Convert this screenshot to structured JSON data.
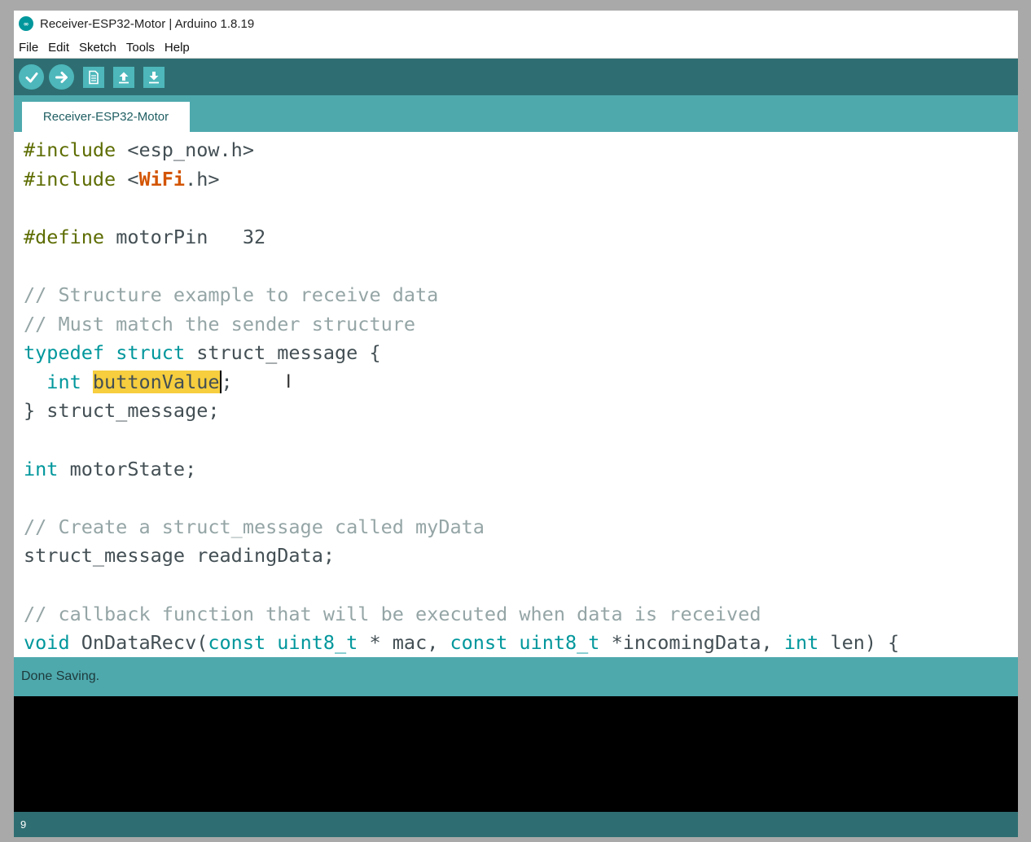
{
  "window": {
    "title": "Receiver-ESP32-Motor | Arduino 1.8.19",
    "app_icon_text": "∞"
  },
  "menu": [
    "File",
    "Edit",
    "Sketch",
    "Tools",
    "Help"
  ],
  "toolbar": {
    "buttons": [
      "verify-icon",
      "upload-icon",
      "new-icon",
      "open-icon",
      "save-icon"
    ]
  },
  "tab": {
    "label": "Receiver-ESP32-Motor"
  },
  "code_lines": [
    [
      {
        "t": "#include",
        "c": "pp"
      },
      {
        "t": " <esp_now.h>"
      }
    ],
    [
      {
        "t": "#include",
        "c": "pp"
      },
      {
        "t": " <"
      },
      {
        "t": "WiFi",
        "c": "lib"
      },
      {
        "t": ".h>"
      }
    ],
    [],
    [
      {
        "t": "#define",
        "c": "pp"
      },
      {
        "t": " motorPin   32"
      }
    ],
    [],
    [
      {
        "t": "// Structure example to receive data",
        "c": "cm"
      }
    ],
    [
      {
        "t": "// Must match the sender structure",
        "c": "cm"
      }
    ],
    [
      {
        "t": "typedef",
        "c": "kw"
      },
      {
        "t": " "
      },
      {
        "t": "struct",
        "c": "kw"
      },
      {
        "t": " struct_message {"
      }
    ],
    [
      {
        "t": "  "
      },
      {
        "t": "int",
        "c": "kw"
      },
      {
        "t": " "
      },
      {
        "t": "buttonValue",
        "c": "hl caret"
      },
      {
        "t": ";"
      }
    ],
    [
      {
        "t": "} struct_message;"
      }
    ],
    [],
    [
      {
        "t": "int",
        "c": "kw"
      },
      {
        "t": " motorState;"
      }
    ],
    [],
    [
      {
        "t": "// Create a struct_message called myData",
        "c": "cm"
      }
    ],
    [
      {
        "t": "struct_message readingData;"
      }
    ],
    [],
    [
      {
        "t": "// callback function that will be executed when data is received",
        "c": "cm"
      }
    ],
    [
      {
        "t": "void",
        "c": "kw"
      },
      {
        "t": " OnDataRecv("
      },
      {
        "t": "const",
        "c": "kw"
      },
      {
        "t": " "
      },
      {
        "t": "uint8_t",
        "c": "kw"
      },
      {
        "t": " * mac, "
      },
      {
        "t": "const",
        "c": "kw"
      },
      {
        "t": " "
      },
      {
        "t": "uint8_t",
        "c": "kw"
      },
      {
        "t": " *incomingData, "
      },
      {
        "t": "int",
        "c": "kw"
      },
      {
        "t": " len) {"
      }
    ]
  ],
  "ibeam_glyph": "I",
  "status": {
    "message": "Done Saving."
  },
  "footer": {
    "line_number": "9"
  },
  "colors": {
    "toolbar": "#2e6e72",
    "tabstrip": "#4ea9ad",
    "button": "#4db7bb",
    "keyword": "#00979c",
    "preprocessor": "#5e6d03",
    "comment": "#95a5a6",
    "library": "#d35400",
    "highlight": "#f6ce3e"
  }
}
